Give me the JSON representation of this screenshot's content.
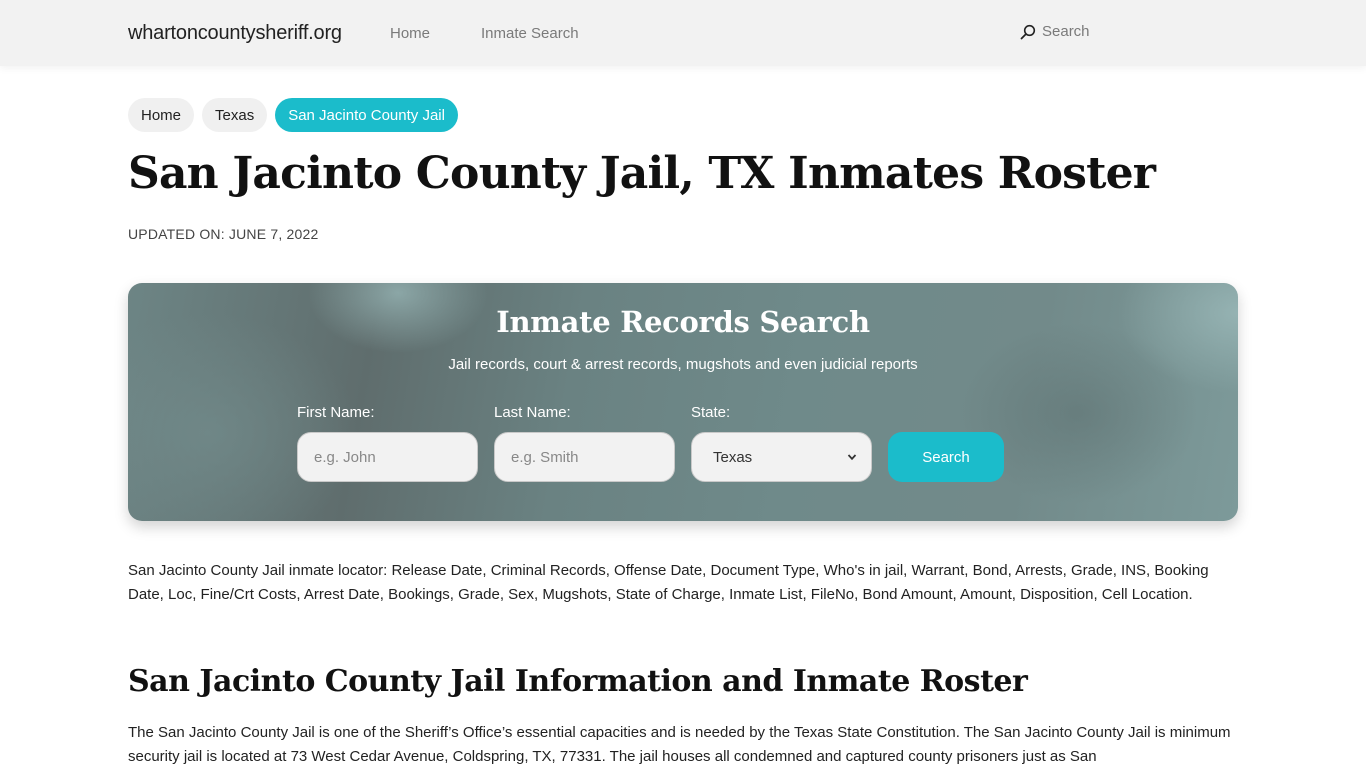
{
  "navbar": {
    "brand": "whartoncountysheriff.org",
    "links": [
      {
        "label": "Home"
      },
      {
        "label": "Inmate Search"
      }
    ],
    "search_label": "Search",
    "search_icon": "search-icon"
  },
  "breadcrumb": [
    {
      "label": "Home"
    },
    {
      "label": "Texas"
    },
    {
      "label": "San Jacinto County Jail",
      "active": true
    }
  ],
  "page": {
    "title": "San Jacinto County Jail, TX Inmates Roster",
    "updated": "UPDATED ON: JUNE 7, 2022"
  },
  "search_card": {
    "title": "Inmate Records Search",
    "subtitle": "Jail records, court & arrest records, mugshots and even judicial reports",
    "first_name": {
      "label": "First Name:",
      "placeholder": "e.g. John",
      "value": ""
    },
    "last_name": {
      "label": "Last Name:",
      "placeholder": "e.g. Smith",
      "value": ""
    },
    "state": {
      "label": "State:",
      "selected": "Texas"
    },
    "button_label": "Search"
  },
  "content": {
    "intro": "San Jacinto County Jail inmate locator: Release Date, Criminal Records, Offense Date, Document Type, Who's in jail, Warrant, Bond, Arrests, Grade, INS, Booking Date, Loc, Fine/Crt Costs, Arrest Date, Bookings, Grade, Sex, Mugshots, State of Charge, Inmate List, FileNo, Bond Amount, Amount, Disposition, Cell Location.",
    "section_title": "San Jacinto County Jail Information and Inmate Roster",
    "section_text": "The San Jacinto County Jail is one of the Sheriff’s Office’s essential capacities and is needed by the Texas State Constitution. The San Jacinto County Jail is minimum security jail is located at 73 West Cedar Avenue, Coldspring, TX, 77331. The jail houses all condemned and captured county prisoners just as San"
  },
  "colors": {
    "accent": "#1bbccb",
    "navbar_bg": "#f2f2f2",
    "card_bg": "#6a8282"
  }
}
